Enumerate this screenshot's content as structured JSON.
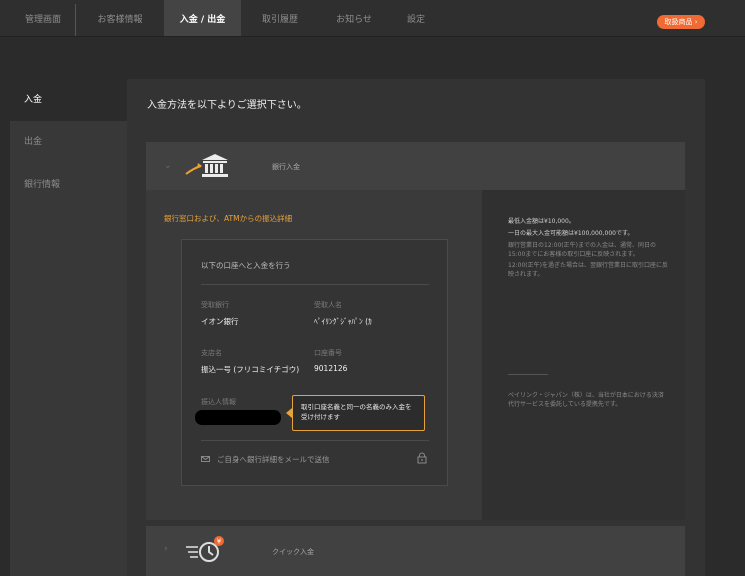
{
  "nav": {
    "tabs": [
      {
        "label": "管理画面"
      },
      {
        "label": "お客様情報"
      },
      {
        "label": "入金 / 出金"
      },
      {
        "label": "取引履歴"
      },
      {
        "label": "お知らせ"
      },
      {
        "label": "設定"
      }
    ],
    "active_tab": "入金 / 出金",
    "badge_label": "取扱商品 ›",
    "accent_color": "#f06a34"
  },
  "sidebar": {
    "items": [
      {
        "label": "入金",
        "active": true
      },
      {
        "label": "出金",
        "active": false
      },
      {
        "label": "銀行情報",
        "active": false
      }
    ]
  },
  "main": {
    "heading": "入金方法を以下よりご選択下さい。",
    "methods": [
      {
        "name": "銀行入金",
        "icon": "bank-icon",
        "expanded": true
      },
      {
        "name": "クイック入金",
        "icon": "quick-deposit-icon",
        "expanded": false
      }
    ],
    "bank": {
      "title": "銀行窓口および、ATMからの振込詳細",
      "box_heading": "以下の口座へと入金を行う",
      "receiving_bank_label": "受取銀行",
      "receiving_bank_value": "イオン銀行",
      "recipient_label": "受取人名",
      "recipient_value": "ﾍﾟｲﾘﾝｸﾞｼﾞｬﾊﾟﾝ (ｶ",
      "branch_label": "支店名",
      "branch_value": "振込一号 (フリコミイチゴウ)",
      "account_label": "口座番号",
      "account_value": "9012126",
      "payer_label": "振込人情報",
      "tooltip": "取引口座名義と同一の名義のみ入金を受け付けます",
      "email_link": "ご自身へ銀行詳細をメールで送信"
    },
    "info": {
      "line1": "最低入金額は¥10,000。",
      "line2": "一日の最大入金可能額は¥100,000,000です。",
      "line3": "銀行営業日の12:00(正午)までの入金は、通常、同日の15:00までにお客様の取引口座に反映されます。",
      "line4": "12:00(正午)を過ぎた場合は、翌銀行営業日に取引口座に反映されます。",
      "line5": "ペイリンク・ジャパン（株）は、当社が日本における決済代行サービスを委託している提携先です。"
    }
  }
}
